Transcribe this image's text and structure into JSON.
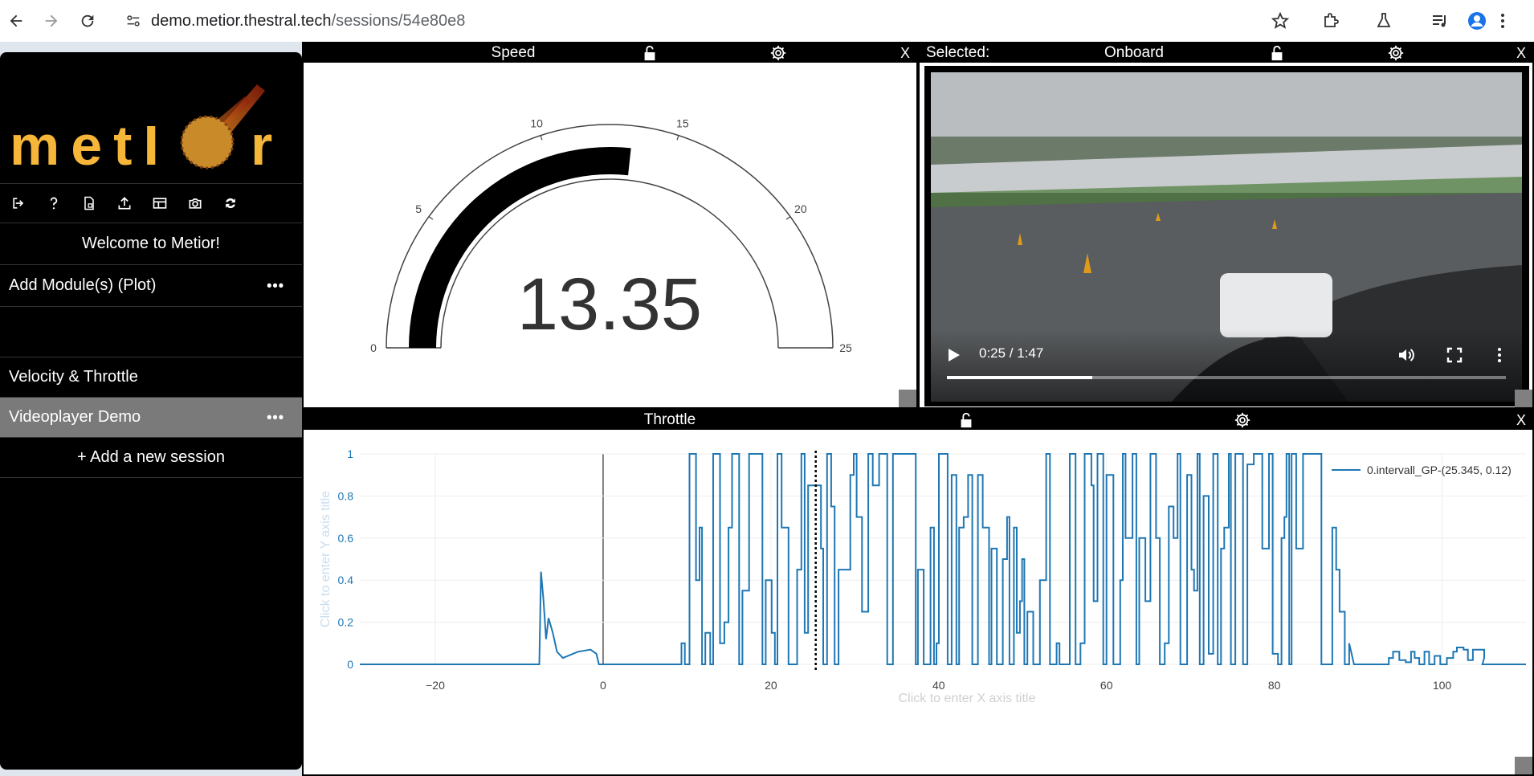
{
  "browser": {
    "url_host": "demo.metior.thestral.tech",
    "url_path": "/sessions/54e80e8"
  },
  "sidebar": {
    "logo_text": "meti r",
    "welcome": "Welcome to Metior!",
    "add_module": "Add Module(s) (Plot)",
    "sessions": [
      {
        "label": "Velocity & Throttle"
      },
      {
        "label": "Videoplayer Demo"
      }
    ],
    "add_session": "+ Add a new session",
    "tools": [
      "logout-icon",
      "help-icon",
      "file-icon",
      "upload-icon",
      "layout-icon",
      "camera-icon",
      "sync-icon"
    ]
  },
  "speed_panel": {
    "title": "Speed",
    "value": "13.35",
    "gauge": {
      "min": 0,
      "max": 25,
      "current": 13.35,
      "ticks": [
        0,
        5,
        10,
        15,
        20,
        25
      ]
    }
  },
  "video_panel": {
    "selected_label": "Selected:",
    "title": "Onboard",
    "time": "0:25 / 1:47",
    "progress": 0.26
  },
  "throttle_panel": {
    "title": "Throttle",
    "x_axis_placeholder": "Click to enter X axis title",
    "y_axis_placeholder": "Click to enter Y axis title",
    "legend": "0.intervall_GP-(25.345, 0.12)"
  },
  "chart_data": {
    "type": "line",
    "series": [
      {
        "name": "0.intervall_GP-(25.345, 0.12)"
      }
    ],
    "x_ticks": [
      "−20",
      "0",
      "20",
      "40",
      "60",
      "80",
      "100"
    ],
    "y_ticks": [
      "0",
      "0.2",
      "0.4",
      "0.6",
      "0.8",
      "1"
    ],
    "xlim": [
      -29,
      110
    ],
    "ylim": [
      0,
      1
    ],
    "cursor_x": 25.345,
    "line_color": "#1f77b4"
  }
}
